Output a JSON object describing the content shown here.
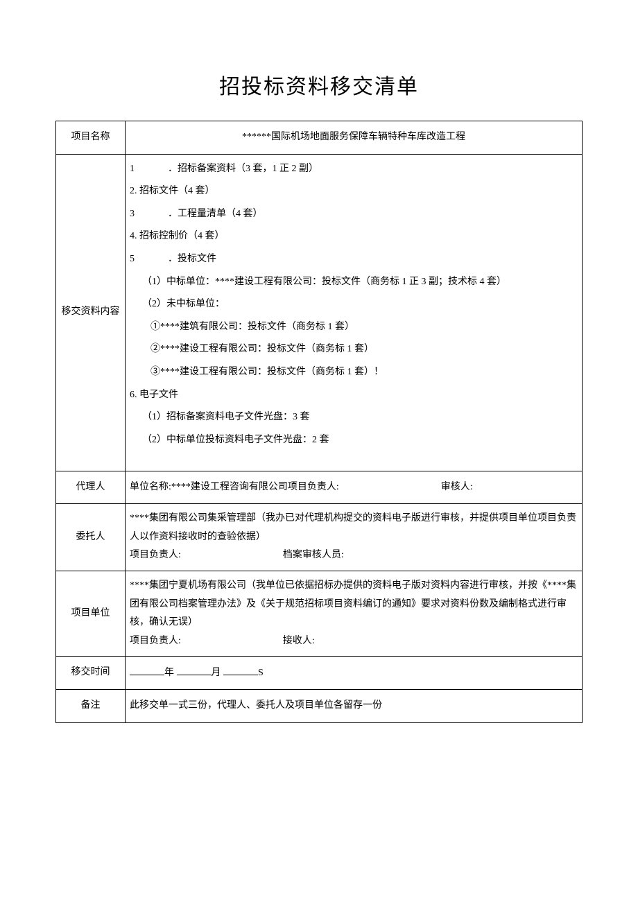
{
  "title": "招投标资料移交清单",
  "rows": {
    "projectName": {
      "label": "项目名称",
      "value": "******国际机场地面服务保障车辆特种车库改造工程"
    },
    "materials": {
      "label": "移交资料内容",
      "items": [
        {
          "num": "1",
          "gap": true,
          "text": "．招标备案资料（3 套，1 正 2 副）"
        },
        {
          "num": "2.",
          "gap": false,
          "text": " 招标文件（4 套）"
        },
        {
          "num": "3",
          "gap": true,
          "text": "．工程量清单（4 套）"
        },
        {
          "num": "4.",
          "gap": false,
          "text": " 招标控制价（4 套）"
        },
        {
          "num": "5",
          "gap": true,
          "text": "．投标文件"
        },
        {
          "indent": 1,
          "text": "（1）中标单位：****建设工程有限公司：投标文件（商务标 1 正 3 副；技术标 4 套）"
        },
        {
          "indent": 1,
          "text": "（2）未中标单位："
        },
        {
          "indent": 2,
          "text": "①****建筑有限公司：投标文件（商务标 1 套）"
        },
        {
          "indent": 2,
          "text": "②****建设工程有限公司：投标文件（商务标 1 套）"
        },
        {
          "indent": 2,
          "text": "③****建设工程有限公司：投标文件（商务标 1 套）！"
        },
        {
          "num": "6.",
          "gap": false,
          "text": " 电子文件"
        },
        {
          "indent": 1,
          "text": "（1）招标备案资料电子文件光盘：3 套"
        },
        {
          "indent": 1,
          "text": "（2）中标单位投标资料电子文件光盘：2 套"
        }
      ]
    },
    "agent": {
      "label": "代理人",
      "prefix": "单位名称:****建设工程咨询有限公司项目负责人:",
      "reviewer": "审核人:"
    },
    "client": {
      "label": "委托人",
      "line1": "****集团有限公司集采管理部（我办已对代理机构提交的资料电子版进行审核，并提供项目单位项目负责人以作资料接收时的查验依据）",
      "pm": "项目负责人:",
      "archiver": "档案审核人员:"
    },
    "unit": {
      "label": "项目单位",
      "line1": "****集团宁夏机场有限公司（我单位已依据招标办提供的资料电子版对资料内容进行审核，并按《****集团有限公司档案管理办法》及《关于规范招标项目资料编订的通知》要求对资料份数及编制格式进行审核，确认无误）",
      "pm": "项目负责人:",
      "receiver": "接收人:"
    },
    "time": {
      "label": "移交时间",
      "year": "年 ",
      "month": "月 ",
      "s": "S"
    },
    "remark": {
      "label": "备注",
      "text": "此移交单一式三份，代理人、委托人及项目单位各留存一份"
    }
  }
}
